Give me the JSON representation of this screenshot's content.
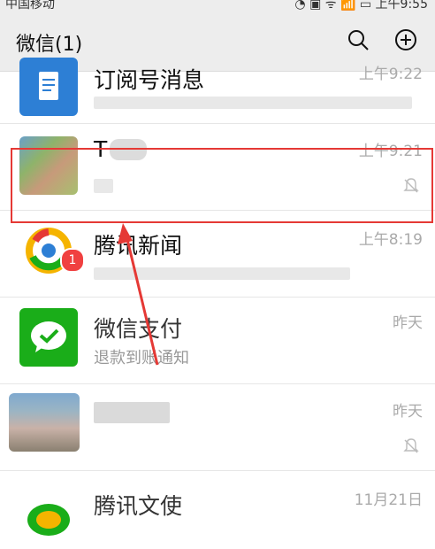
{
  "header": {
    "title": "微信(1)"
  },
  "chats": [
    {
      "name": "订阅号消息",
      "time": "上午9:22",
      "sub": ""
    },
    {
      "name": "T 2",
      "time": "上午9:21",
      "sub": ""
    },
    {
      "name": "腾讯新闻",
      "time": "上午8:19",
      "sub": "",
      "badge": "1"
    },
    {
      "name": "微信支付",
      "time": "昨天",
      "sub": "退款到账通知"
    },
    {
      "name": "",
      "time": "昨天",
      "sub": ""
    },
    {
      "name": "腾讯文使",
      "time": "11月21日",
      "sub": ""
    }
  ],
  "colors": {
    "highlight": "#e53935",
    "badge": "#f04040",
    "pay_green": "#1aad19",
    "doc_blue": "#2d7fd5"
  }
}
